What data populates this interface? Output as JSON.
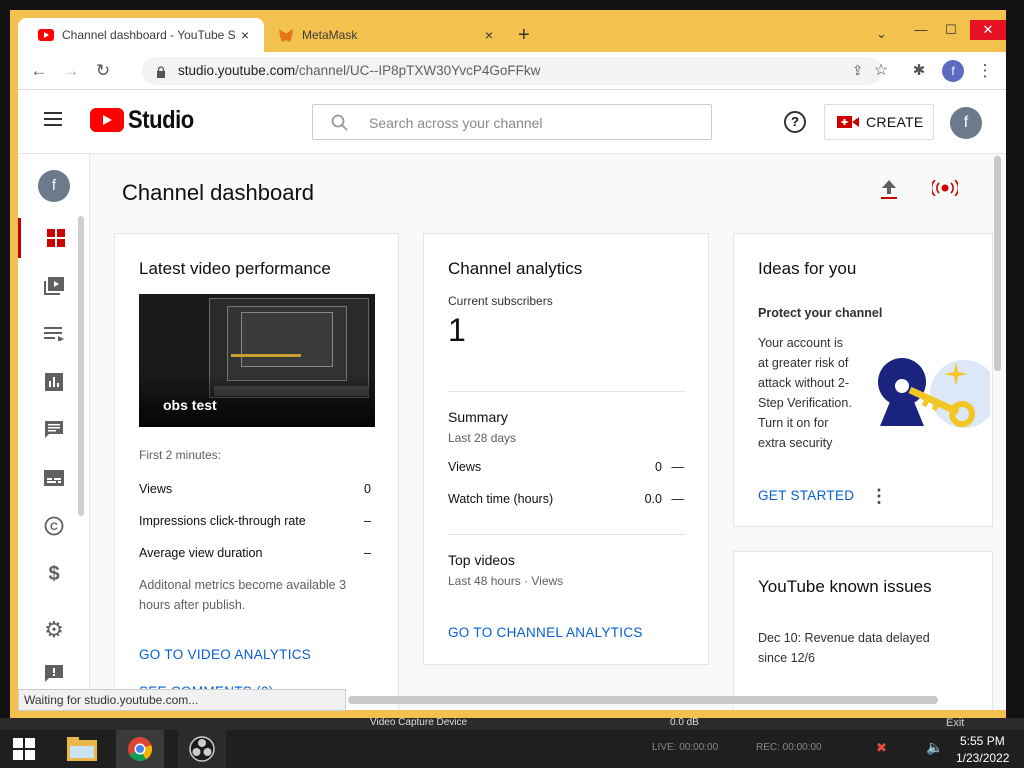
{
  "browser": {
    "tabs": [
      {
        "title": "Channel dashboard - YouTube St",
        "close": "×"
      },
      {
        "title": "MetaMask",
        "close": "×"
      }
    ],
    "new_tab": "+",
    "url_host": "studio.youtube.com",
    "url_path": "/channel/UC--IP8pTXW30YvcP4GoFFkw",
    "profile_initial": "f",
    "status_text": "Waiting for studio.youtube.com..."
  },
  "header": {
    "logo_text": "Studio",
    "search_placeholder": "Search across your channel",
    "create_label": "CREATE",
    "avatar": "f"
  },
  "page": {
    "title": "Channel dashboard"
  },
  "latest": {
    "title": "Latest video performance",
    "thumb_title": "obs test",
    "first_minutes": "First 2 minutes:",
    "metrics": [
      {
        "label": "Views",
        "value": "0"
      },
      {
        "label": "Impressions click-through rate",
        "value": "–"
      },
      {
        "label": "Average view duration",
        "value": "–"
      }
    ],
    "note_1": "Additonal metrics become available 3",
    "note_2": "hours after publish.",
    "link_analytics": "GO TO VIDEO ANALYTICS",
    "link_comments": "SEE COMMENTS (0)"
  },
  "analytics": {
    "title": "Channel analytics",
    "subs_label": "Current subscribers",
    "subs_value": "1",
    "summary_title": "Summary",
    "summary_period": "Last 28 days",
    "rows": [
      {
        "label": "Views",
        "value": "0",
        "trend": "—"
      },
      {
        "label": "Watch time (hours)",
        "value": "0.0",
        "trend": "—"
      }
    ],
    "top_title": "Top videos",
    "top_period": "Last 48 hours · Views",
    "link": "GO TO CHANNEL ANALYTICS"
  },
  "ideas": {
    "title": "Ideas for you",
    "subtitle": "Protect your channel",
    "body": [
      "Your account is",
      "at greater risk of",
      "attack without 2-",
      "Step Verification.",
      "Turn it on for",
      "extra security"
    ],
    "cta": "GET STARTED"
  },
  "issues": {
    "title": "YouTube known issues",
    "line1": "Dec 10: Revenue data delayed",
    "line2": "since 12/6"
  },
  "obs": {
    "device": "Video Capture Device",
    "db": "0.0 dB",
    "exit": "Exit",
    "live": "LIVE: 00:00:00",
    "rec": "REC: 00:00:00"
  },
  "taskbar": {
    "time": "5:55 PM",
    "date": "1/23/2022"
  },
  "colors": {
    "yt_red": "#ff0000",
    "link_blue": "#065fd4",
    "frame": "#f2c14e"
  }
}
